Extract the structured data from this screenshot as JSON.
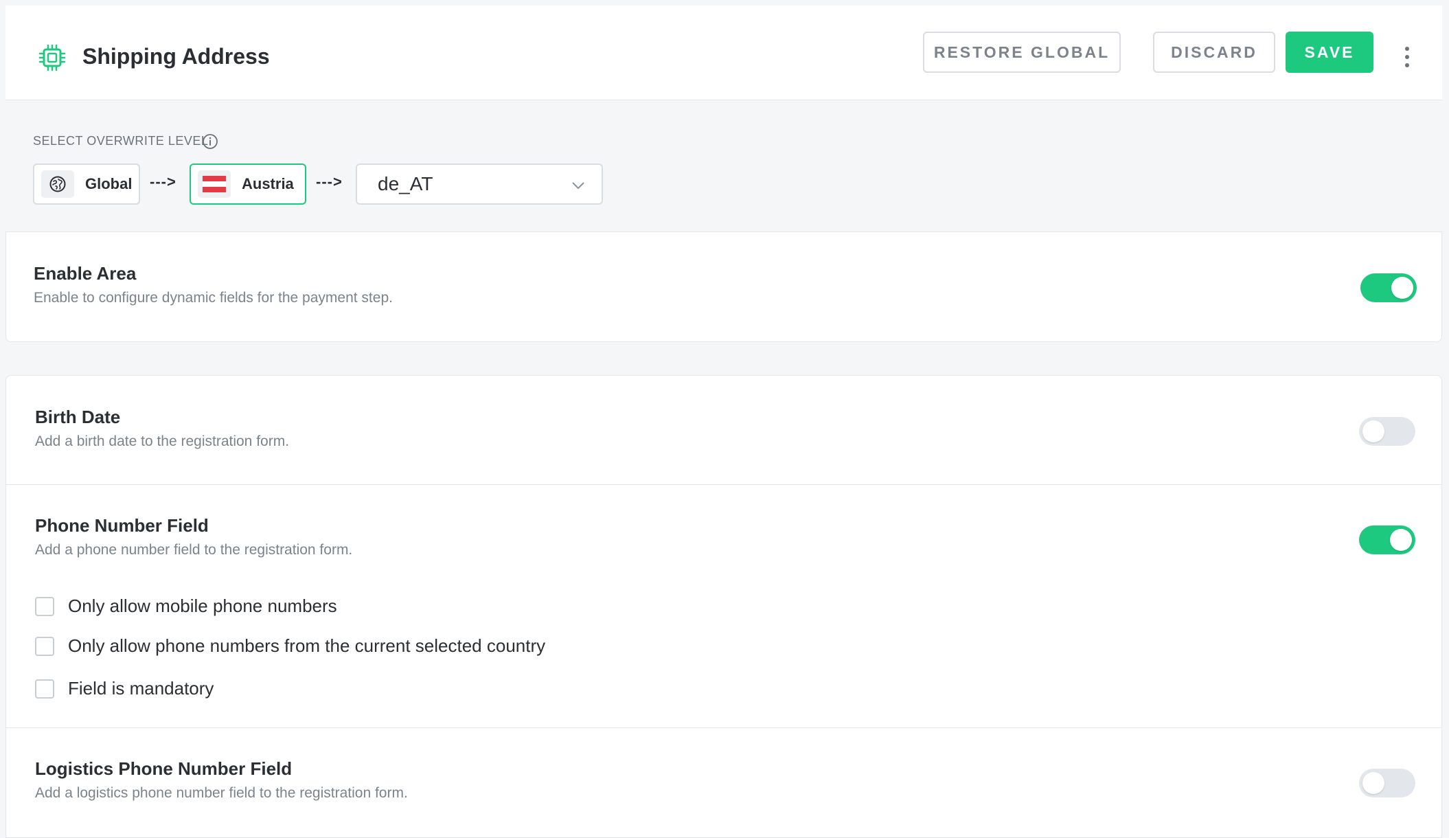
{
  "header": {
    "title": "Shipping Address",
    "app_icon": "chip-icon",
    "restore_label": "RESTORE GLOBAL",
    "discard_label": "DISCARD",
    "save_label": "SAVE"
  },
  "overwrite": {
    "label": "SELECT OVERWRITE LEVEL",
    "levels": [
      {
        "label": "Global",
        "icon": "globe-icon"
      },
      {
        "label": "Austria",
        "icon": "austria-flag-icon"
      }
    ],
    "arrow": "--->",
    "locale_value": "de_AT"
  },
  "enable_area": {
    "title": "Enable Area",
    "description": "Enable to configure dynamic fields for the payment step.",
    "enabled": true
  },
  "fields": [
    {
      "title": "Birth Date",
      "description": "Add a birth date to the registration form.",
      "enabled": false
    },
    {
      "title": "Phone Number Field",
      "description": "Add a phone number field to the registration form.",
      "enabled": true,
      "options": [
        {
          "label": "Only allow mobile phone numbers",
          "checked": false
        },
        {
          "label": "Only allow phone numbers from the current selected country",
          "checked": false
        },
        {
          "label": "Field is mandatory",
          "checked": false
        }
      ]
    },
    {
      "title": "Logistics Phone Number Field",
      "description": "Add a logistics phone number field to the registration form.",
      "enabled": false
    }
  ],
  "colors": {
    "accent": "#1dc87f",
    "flag_red": "#e53945",
    "border": "#d9dde2",
    "muted_text": "#7c838c"
  }
}
